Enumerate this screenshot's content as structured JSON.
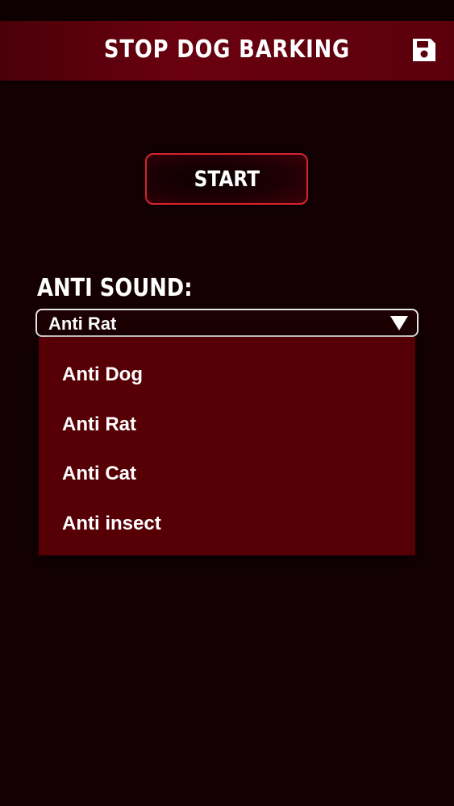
{
  "header": {
    "title": "STOP DOG BARKING",
    "save_icon": "save-icon"
  },
  "main": {
    "start_label": "START",
    "anti_sound_label": "ANTI SOUND:",
    "select": {
      "selected": "Anti Rat",
      "arrow_icon": "triangle-down-icon",
      "options": [
        "Anti Dog",
        "Anti Rat",
        "Anti Cat",
        "Anti insect"
      ]
    }
  },
  "colors": {
    "background": "#140003",
    "header": "#5a000c",
    "accent_border": "#d8232f",
    "dropdown_bg": "#560006",
    "text": "#ffffff"
  }
}
